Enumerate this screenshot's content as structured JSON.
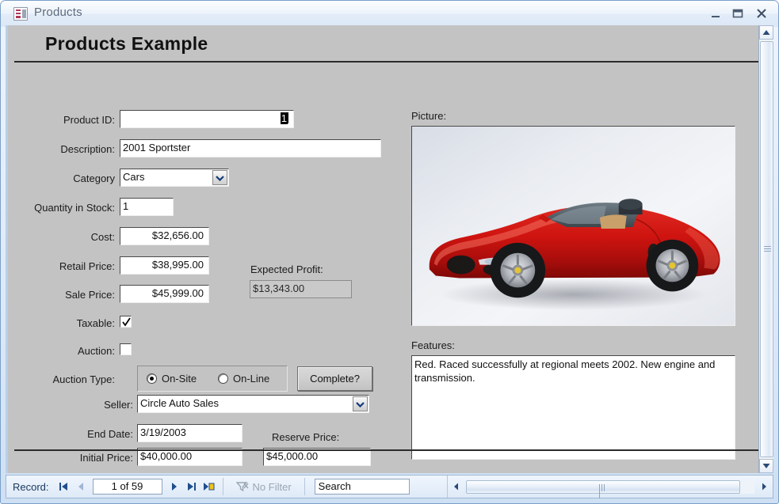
{
  "window": {
    "title": "Products",
    "icon": "access-form-icon",
    "minimize_label": "Minimize",
    "restore_label": "Restore",
    "close_label": "Close"
  },
  "form": {
    "title": "Products Example",
    "fields": {
      "product_id": {
        "label": "Product ID:",
        "value": "1"
      },
      "description": {
        "label": "Description:",
        "value": "2001 Sportster"
      },
      "category": {
        "label": "Category",
        "value": "Cars"
      },
      "quantity": {
        "label": "Quantity in Stock:",
        "value": "1"
      },
      "cost": {
        "label": "Cost:",
        "value": "$32,656.00"
      },
      "retail_price": {
        "label": "Retail Price:",
        "value": "$38,995.00"
      },
      "sale_price": {
        "label": "Sale Price:",
        "value": "$45,999.00"
      },
      "expected_profit": {
        "label": "Expected Profit:",
        "value": "$13,343.00"
      },
      "taxable": {
        "label": "Taxable:",
        "checked": true
      },
      "auction": {
        "label": "Auction:",
        "checked": false
      },
      "auction_type": {
        "label": "Auction Type:",
        "options": [
          "On-Site",
          "On-Line"
        ],
        "selected": "On-Site"
      },
      "complete_button": {
        "label": "Complete?"
      },
      "seller": {
        "label": "Seller:",
        "value": "Circle Auto Sales"
      },
      "end_date": {
        "label": "End Date:",
        "value": "3/19/2003"
      },
      "initial_price": {
        "label": "Initial Price:",
        "value": "$40,000.00"
      },
      "reserve_price": {
        "label": "Reserve Price:",
        "value": "$45,000.00"
      },
      "picture": {
        "label": "Picture:",
        "alt": "red convertible sports car"
      },
      "features": {
        "label": "Features:",
        "value": "Red. Raced successfully at regional meets 2002. New engine and transmission."
      }
    }
  },
  "navigation": {
    "record_label": "Record:",
    "record_position": "1 of 59",
    "first_label": "First record",
    "previous_label": "Previous record",
    "next_label": "Next record",
    "last_label": "Last record",
    "new_label": "New (blank) record",
    "filter_label": "No Filter",
    "search_value": "Search"
  },
  "colors": {
    "form_background": "#c3c3c3",
    "chrome": "#dfeaf8",
    "accent": "#17375e"
  }
}
